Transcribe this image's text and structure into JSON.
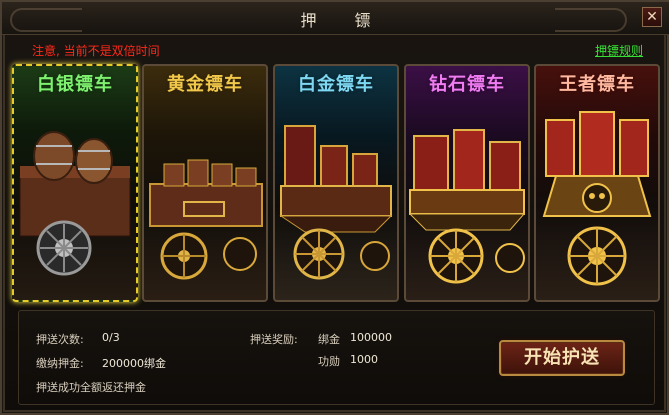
{
  "window": {
    "title": "押　　镖",
    "close_glyph": "✕"
  },
  "notice": "注意, 当前不是双倍时间",
  "rules_link": "押镖规则",
  "carts": [
    {
      "name": "白银镖车",
      "selected": true
    },
    {
      "name": "黄金镖车",
      "selected": false
    },
    {
      "name": "白金镖车",
      "selected": false
    },
    {
      "name": "钻石镖车",
      "selected": false
    },
    {
      "name": "王者镖车",
      "selected": false
    }
  ],
  "info": {
    "escort_count_label": "押送次数:",
    "escort_count_value": "0/3",
    "deposit_label": "缴纳押金:",
    "deposit_value": "200000绑金",
    "refund_note": "押送成功全额返还押金",
    "reward_label": "押送奖励:",
    "rewards": [
      {
        "name": "绑金",
        "value": "100000"
      },
      {
        "name": "功勋",
        "value": "1000"
      }
    ]
  },
  "start_button": "开始护送",
  "colors": {
    "notice": "#ff2a1a",
    "link": "#38e035",
    "selected_border": "#e6cc28",
    "silver_title": "#7ff070",
    "gold_title": "#f1c84a",
    "platinum_title": "#7fd8f2",
    "diamond_title": "#f07cf2",
    "king_title": "#ffb9a0"
  }
}
